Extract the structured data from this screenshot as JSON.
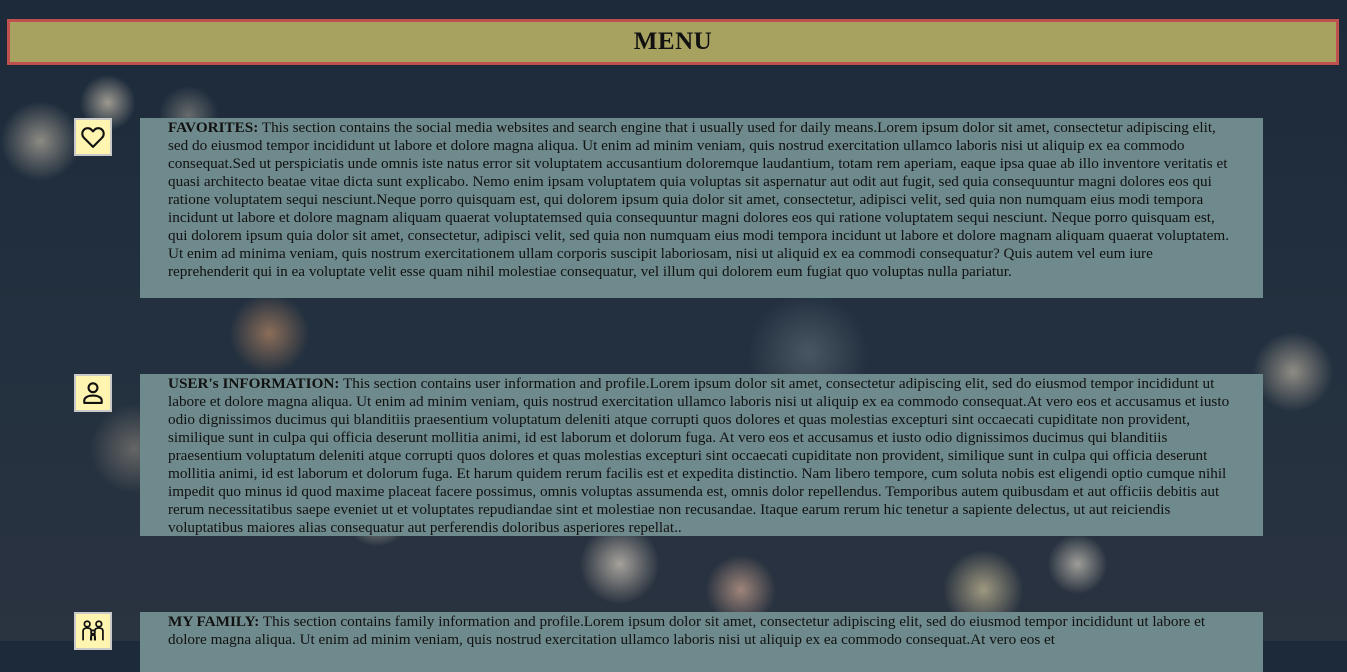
{
  "menu": {
    "title": "MENU"
  },
  "sections": [
    {
      "icon": "heart-icon",
      "heading": "FAVORITES:",
      "text": " This section contains the social media websites and search engine that i usually used for daily means.Lorem ipsum dolor sit amet, consectetur adipiscing elit, sed do eiusmod tempor incididunt ut labore et dolore magna aliqua. Ut enim ad minim veniam, quis nostrud exercitation ullamco laboris nisi ut aliquip ex ea commodo consequat.Sed ut perspiciatis unde omnis iste natus error sit voluptatem accusantium doloremque laudantium, totam rem aperiam, eaque ipsa quae ab illo inventore veritatis et quasi architecto beatae vitae dicta sunt explicabo. Nemo enim ipsam voluptatem quia voluptas sit aspernatur aut odit aut fugit, sed quia consequuntur magni dolores eos qui ratione voluptatem sequi nesciunt.Neque porro quisquam est, qui dolorem ipsum quia dolor sit amet, consectetur, adipisci velit, sed quia non numquam eius modi tempora incidunt ut labore et dolore magnam aliquam quaerat voluptatemsed quia consequuntur magni dolores eos qui ratione voluptatem sequi nesciunt. Neque porro quisquam est, qui dolorem ipsum quia dolor sit amet, consectetur, adipisci velit, sed quia non numquam eius modi tempora incidunt ut labore et dolore magnam aliquam quaerat voluptatem. Ut enim ad minima veniam, quis nostrum exercitationem ullam corporis suscipit laboriosam, nisi ut aliquid ex ea commodi consequatur? Quis autem vel eum iure reprehenderit qui in ea voluptate velit esse quam nihil molestiae consequatur, vel illum qui dolorem eum fugiat quo voluptas nulla pariatur."
    },
    {
      "icon": "user-icon",
      "heading": "USER's INFORMATION:",
      "text": " This section contains user information and profile.Lorem ipsum dolor sit amet, consectetur adipiscing elit, sed do eiusmod tempor incididunt ut labore et dolore magna aliqua. Ut enim ad minim veniam, quis nostrud exercitation ullamco laboris nisi ut aliquip ex ea commodo consequat.At vero eos et accusamus et iusto odio dignissimos ducimus qui blanditiis praesentium voluptatum deleniti atque corrupti quos dolores et quas molestias excepturi sint occaecati cupiditate non provident, similique sunt in culpa qui officia deserunt mollitia animi, id est laborum et dolorum fuga. At vero eos et accusamus et iusto odio dignissimos ducimus qui blanditiis praesentium voluptatum deleniti atque corrupti quos dolores et quas molestias excepturi sint occaecati cupiditate non provident, similique sunt in culpa qui officia deserunt mollitia animi, id est laborum et dolorum fuga. Et harum quidem rerum facilis est et expedita distinctio. Nam libero tempore, cum soluta nobis est eligendi optio cumque nihil impedit quo minus id quod maxime placeat facere possimus, omnis voluptas assumenda est, omnis dolor repellendus. Temporibus autem quibusdam et aut officiis debitis aut rerum necessitatibus saepe eveniet ut et voluptates repudiandae sint et molestiae non recusandae. Itaque earum rerum hic tenetur a sapiente delectus, ut aut reiciendis voluptatibus maiores alias consequatur aut perferendis doloribus asperiores repellat.."
    },
    {
      "icon": "family-icon",
      "heading": "MY FAMILY:",
      "text": " This section contains family information and profile.Lorem ipsum dolor sit amet, consectetur adipiscing elit, sed do eiusmod tempor incididunt ut labore et dolore magna aliqua. Ut enim ad minim veniam, quis nostrud exercitation ullamco laboris nisi ut aliquip ex ea commodo consequat.At vero eos et"
    }
  ],
  "colors": {
    "menu_bg": "#a8a261",
    "menu_border": "#c0504d",
    "section_bg": "#6f8a8c",
    "icon_bg": "#fff5b0"
  }
}
